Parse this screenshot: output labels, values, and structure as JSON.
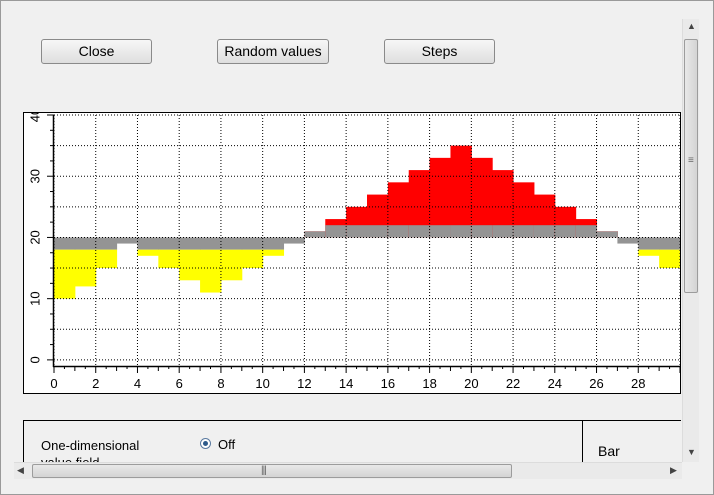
{
  "toolbar": {
    "close_label": "Close",
    "random_label": "Random values",
    "steps_label": "Steps"
  },
  "colors": {
    "above": "#ff0000",
    "below": "#ffff00",
    "base": "#949494"
  },
  "chart_data": {
    "type": "bar",
    "xlim": [
      0,
      30
    ],
    "ylim": [
      -1,
      40
    ],
    "xticks": [
      "0",
      "2",
      "4",
      "6",
      "8",
      "10",
      "12",
      "14",
      "16",
      "18",
      "20",
      "22",
      "24",
      "26",
      "28"
    ],
    "yticks": [
      "0",
      "10",
      "20",
      "30",
      "40"
    ],
    "grid": true,
    "reference": 20,
    "base_band": [
      18,
      20
    ],
    "x": [
      0,
      1,
      2,
      3,
      4,
      5,
      6,
      7,
      8,
      9,
      10,
      11,
      12,
      13,
      14,
      15,
      16,
      17,
      18,
      19,
      20,
      21,
      22,
      23,
      24,
      25,
      26,
      27,
      28,
      29
    ],
    "values": [
      10,
      12,
      15,
      19,
      17,
      15,
      13,
      11,
      13,
      15,
      17,
      19,
      21,
      23,
      25,
      27,
      29,
      31,
      33,
      35,
      33,
      31,
      29,
      27,
      25,
      23,
      21,
      19,
      17,
      15
    ]
  },
  "panel": {
    "field_label": "One-dimensional value field",
    "radio_label": "Off",
    "type_label": "Bar"
  }
}
